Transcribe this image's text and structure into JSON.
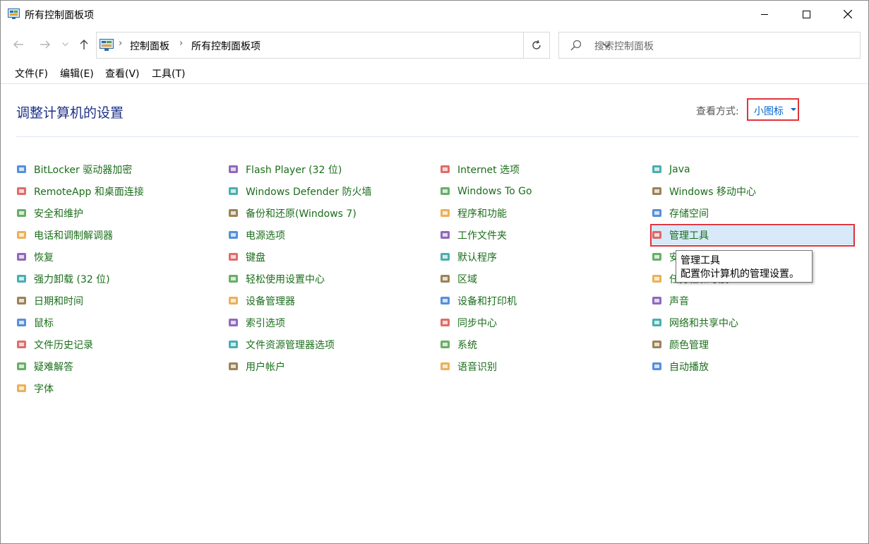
{
  "window": {
    "title": "所有控制面板项"
  },
  "address": {
    "crumbs": [
      "控制面板",
      "所有控制面板项"
    ]
  },
  "search": {
    "placeholder": "搜索控制面板"
  },
  "menu": [
    "文件(F)",
    "编辑(E)",
    "查看(V)",
    "工具(T)"
  ],
  "content": {
    "page_title": "调整计算机的设置",
    "view_label": "查看方式:",
    "view_value": "小图标"
  },
  "columns": [
    {
      "items": [
        {
          "label": "BitLocker 驱动器加密",
          "icon": "bitlocker-icon"
        },
        {
          "label": "RemoteApp 和桌面连接",
          "icon": "remoteapp-icon"
        },
        {
          "label": "安全和维护",
          "icon": "flag-icon"
        },
        {
          "label": "电话和调制解调器",
          "icon": "phone-modem-icon"
        },
        {
          "label": "恢复",
          "icon": "recovery-icon"
        },
        {
          "label": "强力卸载 (32 位)",
          "icon": "uninstall-icon"
        },
        {
          "label": "日期和时间",
          "icon": "datetime-icon"
        },
        {
          "label": "鼠标",
          "icon": "mouse-icon"
        },
        {
          "label": "文件历史记录",
          "icon": "file-history-icon"
        },
        {
          "label": "疑难解答",
          "icon": "troubleshoot-icon"
        },
        {
          "label": "字体",
          "icon": "fonts-icon"
        }
      ]
    },
    {
      "items": [
        {
          "label": "Flash Player (32 位)",
          "icon": "flash-icon"
        },
        {
          "label": "Windows Defender 防火墙",
          "icon": "firewall-icon"
        },
        {
          "label": "备份和还原(Windows 7)",
          "icon": "backup-icon"
        },
        {
          "label": "电源选项",
          "icon": "power-icon"
        },
        {
          "label": "键盘",
          "icon": "keyboard-icon"
        },
        {
          "label": "轻松使用设置中心",
          "icon": "ease-of-access-icon"
        },
        {
          "label": "设备管理器",
          "icon": "device-manager-icon"
        },
        {
          "label": "索引选项",
          "icon": "indexing-icon"
        },
        {
          "label": "文件资源管理器选项",
          "icon": "folder-options-icon"
        },
        {
          "label": "用户帐户",
          "icon": "user-accounts-icon"
        }
      ]
    },
    {
      "items": [
        {
          "label": "Internet 选项",
          "icon": "internet-icon"
        },
        {
          "label": "Windows To Go",
          "icon": "windows-to-go-icon"
        },
        {
          "label": "程序和功能",
          "icon": "programs-icon"
        },
        {
          "label": "工作文件夹",
          "icon": "work-folders-icon"
        },
        {
          "label": "默认程序",
          "icon": "default-programs-icon"
        },
        {
          "label": "区域",
          "icon": "region-icon"
        },
        {
          "label": "设备和打印机",
          "icon": "printer-icon"
        },
        {
          "label": "同步中心",
          "icon": "sync-icon"
        },
        {
          "label": "系统",
          "icon": "system-icon"
        },
        {
          "label": "语音识别",
          "icon": "microphone-icon"
        }
      ]
    },
    {
      "items": [
        {
          "label": "Java",
          "icon": "java-icon"
        },
        {
          "label": "Windows 移动中心",
          "icon": "mobility-icon"
        },
        {
          "label": "存储空间",
          "icon": "storage-icon"
        },
        {
          "label": "管理工具",
          "icon": "admin-tools-icon"
        },
        {
          "label": "安全",
          "icon": "credential-icon"
        },
        {
          "label": "任务栏和导航",
          "icon": "taskbar-icon"
        },
        {
          "label": "声音",
          "icon": "sound-icon"
        },
        {
          "label": "网络和共享中心",
          "icon": "network-icon"
        },
        {
          "label": "颜色管理",
          "icon": "color-icon"
        },
        {
          "label": "自动播放",
          "icon": "autoplay-icon"
        }
      ]
    }
  ],
  "tooltip": {
    "title": "管理工具",
    "description": "配置你计算机的管理设置。"
  }
}
